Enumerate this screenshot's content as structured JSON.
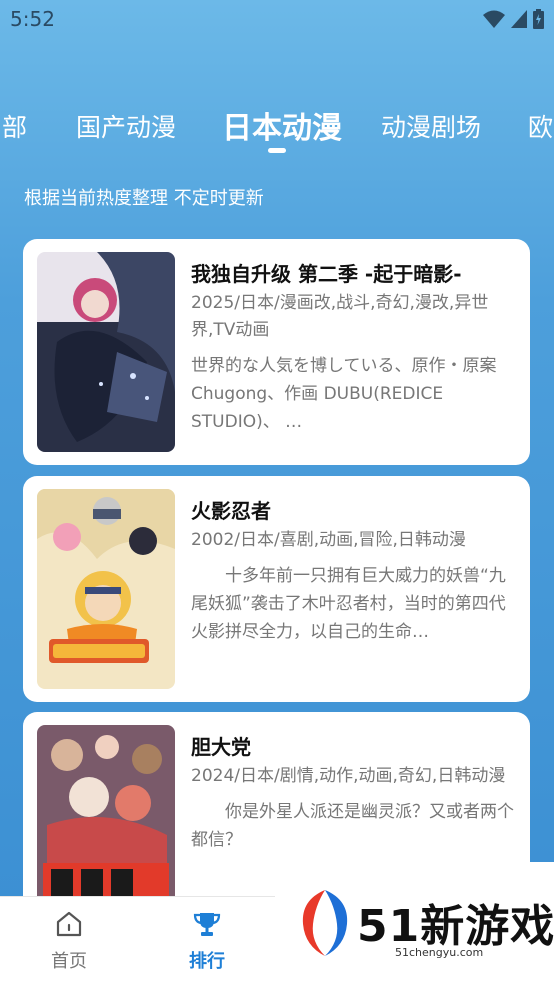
{
  "status_bar": {
    "time": "5:52"
  },
  "tabs": [
    {
      "label": "部"
    },
    {
      "label": "国产动漫"
    },
    {
      "label": "日本动漫"
    },
    {
      "label": "动漫剧场"
    },
    {
      "label": "欧"
    }
  ],
  "subtitle": "根据当前热度整理 不定时更新",
  "cards": [
    {
      "title": "我独自升级 第二季 -起于暗影-",
      "meta": "2025/日本/漫画改,战斗,奇幻,漫改,异世界,TV动画",
      "desc": "世界的な人気を博している、原作・原案 Chugong、作画 DUBU(REDICE STUDIO)、 …"
    },
    {
      "title": "火影忍者",
      "meta": "2002/日本/喜剧,动画,冒险,日韩动漫",
      "desc": "十多年前一只拥有巨大威力的妖兽“九尾妖狐”袭击了木叶忍者村，当时的第四代火影拼尽全力，以自己的生命…"
    },
    {
      "title": "胆大党",
      "meta": "2024/日本/剧情,动作,动画,奇幻,日韩动漫",
      "desc": "你是外星人派还是幽灵派？又或者两个都信？"
    }
  ],
  "bottom_nav": [
    {
      "label": "首页",
      "icon": "home-icon"
    },
    {
      "label": "排行",
      "icon": "trophy-icon"
    }
  ],
  "watermark": {
    "text": "51新游戏",
    "url": "51chengyu.com"
  },
  "colors": {
    "accent": "#1e7fd6",
    "background": "#4d9fdb"
  }
}
